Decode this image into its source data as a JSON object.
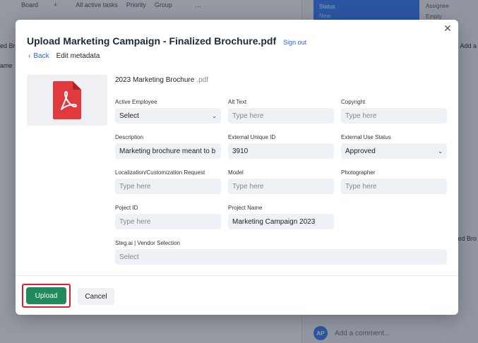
{
  "background": {
    "toolbar": [
      "Board",
      "+",
      "All active tasks",
      "Priority",
      "Group",
      "…"
    ],
    "status_header": "Status",
    "status_value": "New",
    "assignee_header": "Assignee",
    "assignee_value": "Empty",
    "left_snippets": [
      "ed Br",
      "ame"
    ],
    "right_snippets": [
      "Add a",
      "ed Bro"
    ],
    "avatar_initials": "AP",
    "comment_placeholder": "Add a comment..."
  },
  "modal": {
    "title": "Upload Marketing Campaign - Finalized Brochure.pdf",
    "sign_out": "Sign out",
    "back": "Back",
    "breadcrumb": "Edit metadata",
    "file_name": "2023 Marketing Brochure",
    "file_ext": ".pdf",
    "thumbnail_icon": "pdf-file-icon",
    "fields": {
      "active_employee": {
        "label": "Active Employee",
        "value": "Select"
      },
      "alt_text": {
        "label": "Alt Text",
        "placeholder": "Type here"
      },
      "copyright": {
        "label": "Copyright",
        "placeholder": "Type here"
      },
      "description": {
        "label": "Description",
        "value": "Marketing brochure meant to b"
      },
      "external_unique_id": {
        "label": "External Unique ID",
        "value": "3910"
      },
      "external_use_status": {
        "label": "External Use Status",
        "value": "Approved"
      },
      "localization": {
        "label": "Localization/Customization Request",
        "placeholder": "Type here"
      },
      "model": {
        "label": "Model",
        "placeholder": "Type here"
      },
      "photographer": {
        "label": "Photographer",
        "placeholder": "Type here"
      },
      "project_id": {
        "label": "Poject ID",
        "placeholder": "Type here"
      },
      "project_name": {
        "label": "Project Name",
        "value": "Marketing Campaign 2023"
      },
      "vendor_selection": {
        "label": "Steg.ai | Vendor Selection",
        "placeholder": "Select"
      }
    },
    "upload_label": "Upload",
    "cancel_label": "Cancel",
    "colors": {
      "upload": "#1f8a5a",
      "highlight": "#e11d2a",
      "link": "#2563eb",
      "pdf": "#e03a3e"
    }
  }
}
